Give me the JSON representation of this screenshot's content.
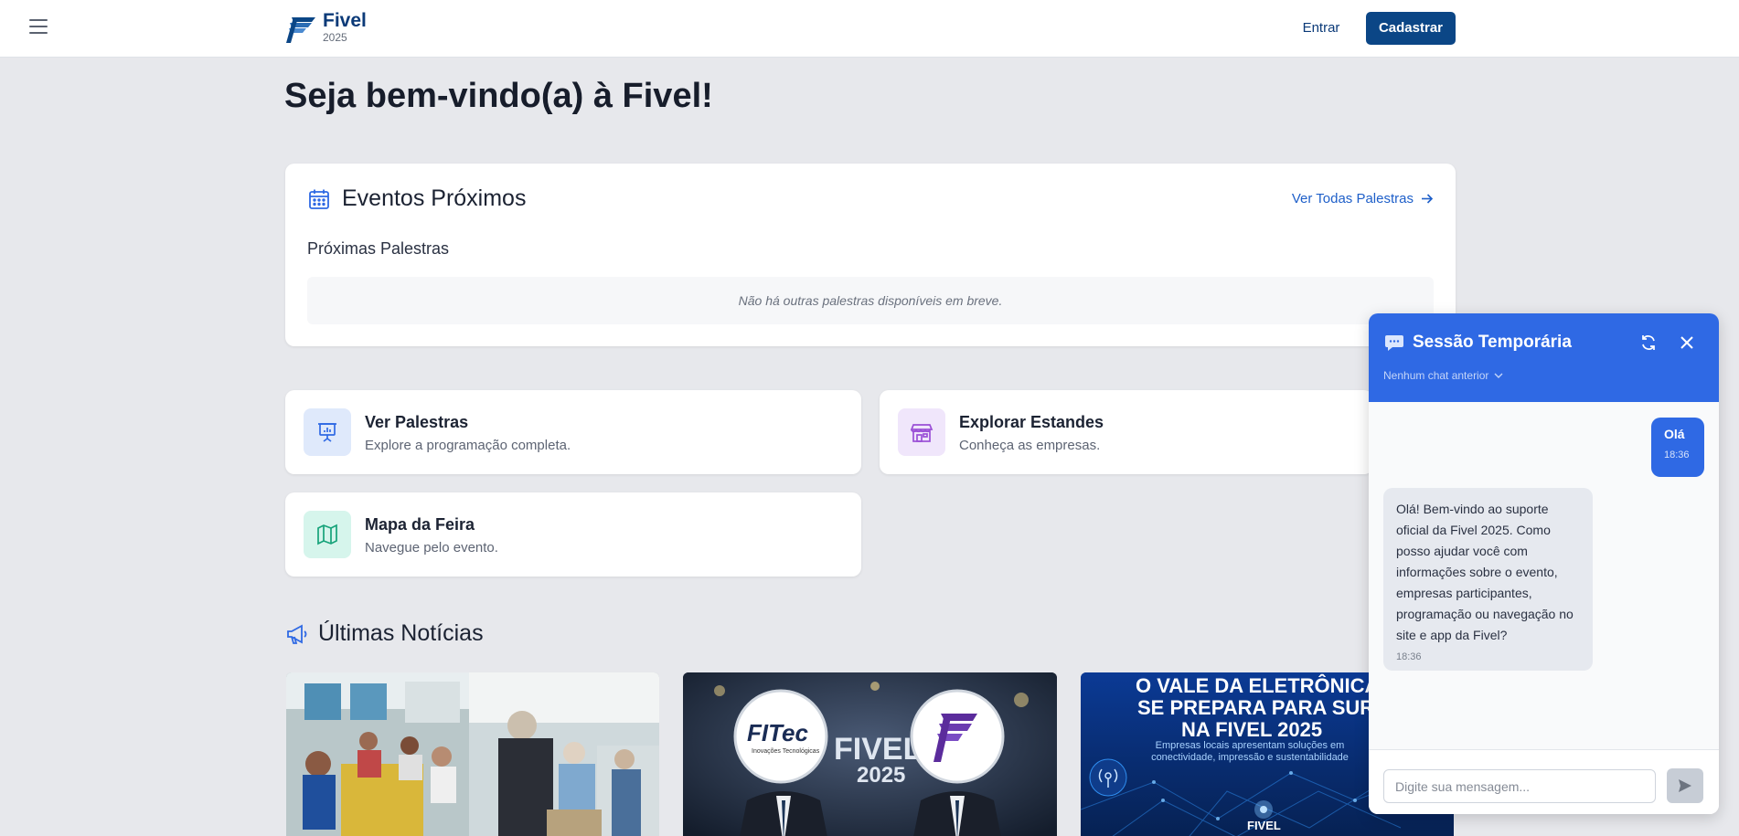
{
  "header": {
    "brand_name": "Fivel",
    "brand_year": "2025",
    "login_label": "Entrar",
    "signup_label": "Cadastrar"
  },
  "welcome_title": "Seja bem-vindo(a) à Fivel!",
  "events": {
    "title": "Eventos Próximos",
    "see_all_label": "Ver Todas Palestras",
    "next_title": "Próximas Palestras",
    "empty_message": "Não há outras palestras disponíveis em breve."
  },
  "quick_links": [
    {
      "title": "Ver Palestras",
      "description": "Explore a programação completa.",
      "icon": "presentation-icon"
    },
    {
      "title": "Explorar Estandes",
      "description": "Conheça as empresas.",
      "icon": "store-icon"
    },
    {
      "title": "Mapa da Feira",
      "description": "Navegue pelo evento.",
      "icon": "map-icon"
    }
  ],
  "news": {
    "title": "Últimas Notícias",
    "items": [
      {
        "image_description": "photo"
      },
      {
        "image_text_1": "FITec",
        "image_text_2": "Inovações Tecnológicas",
        "image_text_3": "FIVEL",
        "image_text_4": "2025"
      },
      {
        "image_text_1": "O VALE DA ELETRÔNICA",
        "image_text_2": "SE PREPARA PARA SURPREEN",
        "image_text_3": "NA FIVEL 2025",
        "image_text_4": "Empresas locais apresentam soluções em conectividade, impressão e sustentabilidade",
        "image_text_5": "FIVEL"
      }
    ]
  },
  "chat": {
    "title": "Sessão Temporária",
    "previous_label": "Nenhum chat anterior",
    "messages": [
      {
        "from": "user",
        "text": "Olá",
        "time": "18:36"
      },
      {
        "from": "bot",
        "text": "Olá! Bem-vindo ao suporte oficial da Fivel 2025. Como posso ajudar você com informações sobre o evento, empresas participantes, programação ou navegação no site e app da Fivel?",
        "time": "18:36"
      }
    ],
    "input_placeholder": "Digite sua mensagem...",
    "input_value": ""
  },
  "colors": {
    "brand": "#0b4686",
    "accent": "#2f69e4",
    "link": "#1e5fc9"
  }
}
